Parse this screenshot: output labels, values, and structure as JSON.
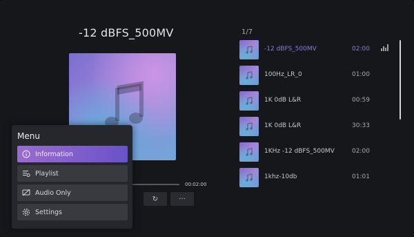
{
  "player": {
    "title": "-12 dBFS_500MV",
    "time_total": "00:02:00",
    "controls": [
      {
        "icon": "repeat-icon",
        "label": "↻"
      },
      {
        "icon": "more-icon",
        "label": "···"
      }
    ]
  },
  "playlist": {
    "count": "1/7",
    "items": [
      {
        "name": "-12 dBFS_500MV",
        "duration": "02:00",
        "active": true
      },
      {
        "name": "100Hz_LR_0",
        "duration": "01:00"
      },
      {
        "name": "1K 0dB L&R",
        "duration": "00:59"
      },
      {
        "name": "1K 0dB L&R",
        "duration": "30:33"
      },
      {
        "name": "1KHz -12 dBFS_500MV",
        "duration": "02:00"
      },
      {
        "name": "1khz-10db",
        "duration": "01:01"
      }
    ]
  },
  "menu": {
    "title": "Menu",
    "items": [
      {
        "label": "Information",
        "icon": "info-icon",
        "active": true
      },
      {
        "label": "Playlist",
        "icon": "playlist-icon"
      },
      {
        "label": "Audio Only",
        "icon": "audio-only-icon"
      },
      {
        "label": "Settings",
        "icon": "gear-icon"
      }
    ]
  },
  "colors": {
    "background": "#16171b",
    "accent": "#8b7bd6",
    "menu_active": "#7e5ccc"
  }
}
